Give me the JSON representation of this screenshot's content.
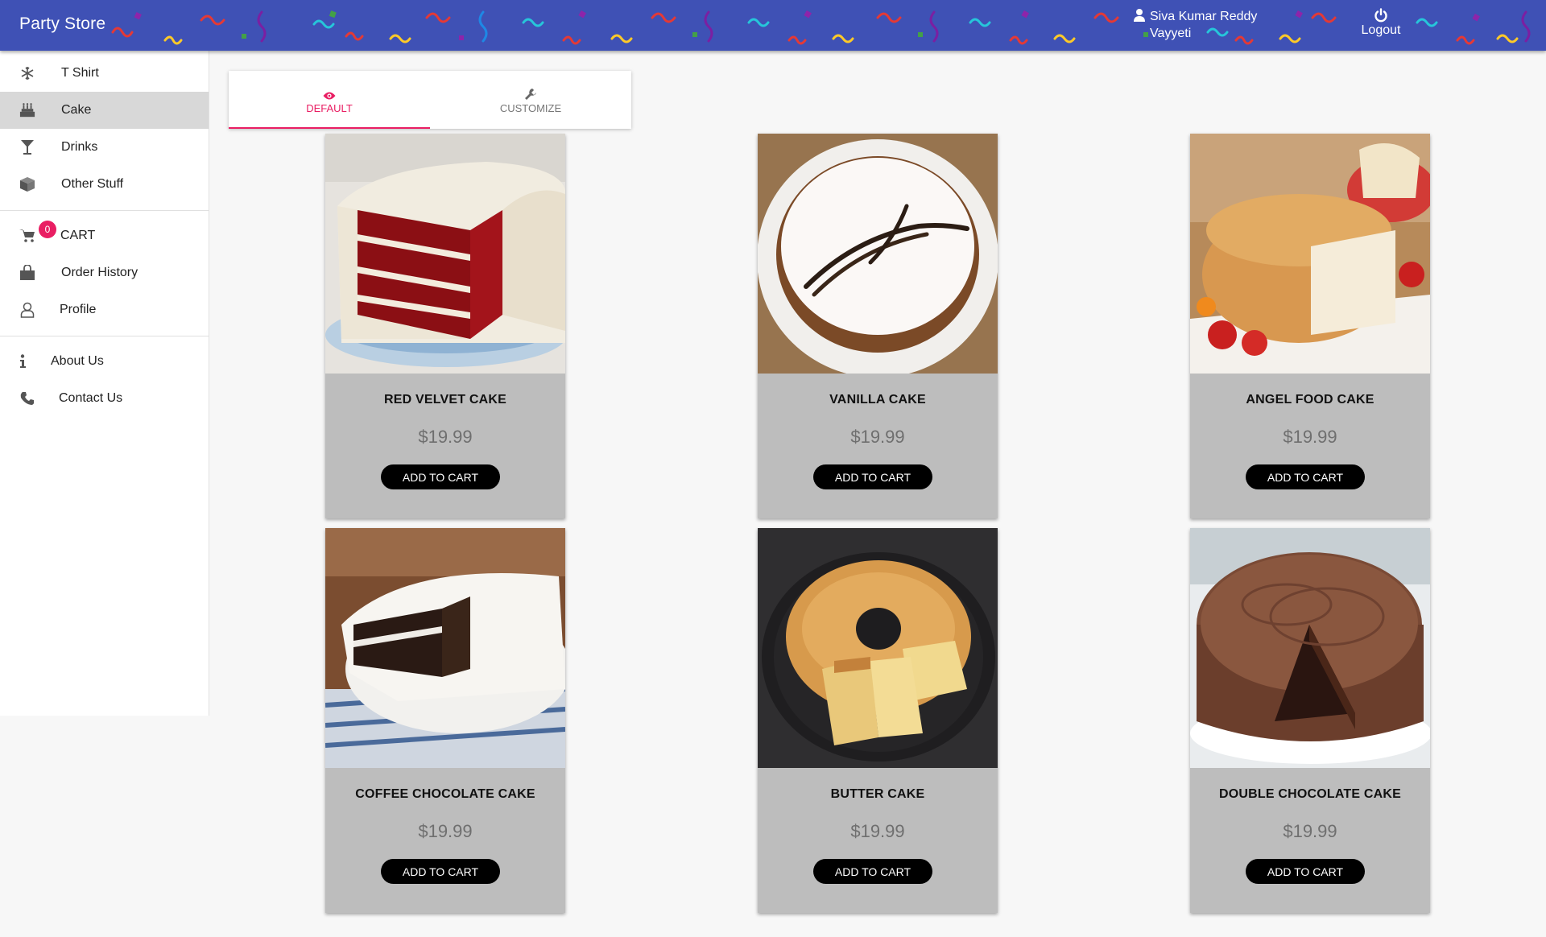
{
  "header": {
    "brand": "Party Store",
    "user_name": "Siva Kumar Reddy Vayyeti",
    "logout_label": "Logout",
    "color": "#3f51b5"
  },
  "sidebar": {
    "items": [
      {
        "label": "T Shirt",
        "icon": "snowflake-icon"
      },
      {
        "label": "Cake",
        "icon": "birthday-cake-icon",
        "active": true
      },
      {
        "label": "Drinks",
        "icon": "cocktail-glass-icon"
      },
      {
        "label": "Other Stuff",
        "icon": "box-icon"
      }
    ],
    "cart": {
      "label": "CART",
      "count": "0",
      "icon": "cart-icon"
    },
    "account_items": [
      {
        "label": "Order History",
        "icon": "shopping-bag-icon"
      },
      {
        "label": "Profile",
        "icon": "user-outline-icon"
      }
    ],
    "info_items": [
      {
        "label": "About Us",
        "icon": "info-icon"
      },
      {
        "label": "Contact Us",
        "icon": "phone-icon"
      }
    ]
  },
  "tabs": [
    {
      "label": "DEFAULT",
      "icon": "eye-icon",
      "active": true
    },
    {
      "label": "CUSTOMIZE",
      "icon": "wrench-icon",
      "active": false
    }
  ],
  "products": [
    {
      "name": "RED VELVET CAKE",
      "price": "$19.99",
      "button": "ADD TO CART"
    },
    {
      "name": "VANILLA CAKE",
      "price": "$19.99",
      "button": "ADD TO CART"
    },
    {
      "name": "ANGEL FOOD CAKE",
      "price": "$19.99",
      "button": "ADD TO CART"
    },
    {
      "name": "COFFEE CHOCOLATE CAKE",
      "price": "$19.99",
      "button": "ADD TO CART"
    },
    {
      "name": "BUTTER CAKE",
      "price": "$19.99",
      "button": "ADD TO CART"
    },
    {
      "name": "DOUBLE CHOCOLATE CAKE",
      "price": "$19.99",
      "button": "ADD TO CART"
    }
  ],
  "colors": {
    "accent": "#e91e63",
    "card_bg": "#bdbdbd",
    "button": "#000000"
  }
}
